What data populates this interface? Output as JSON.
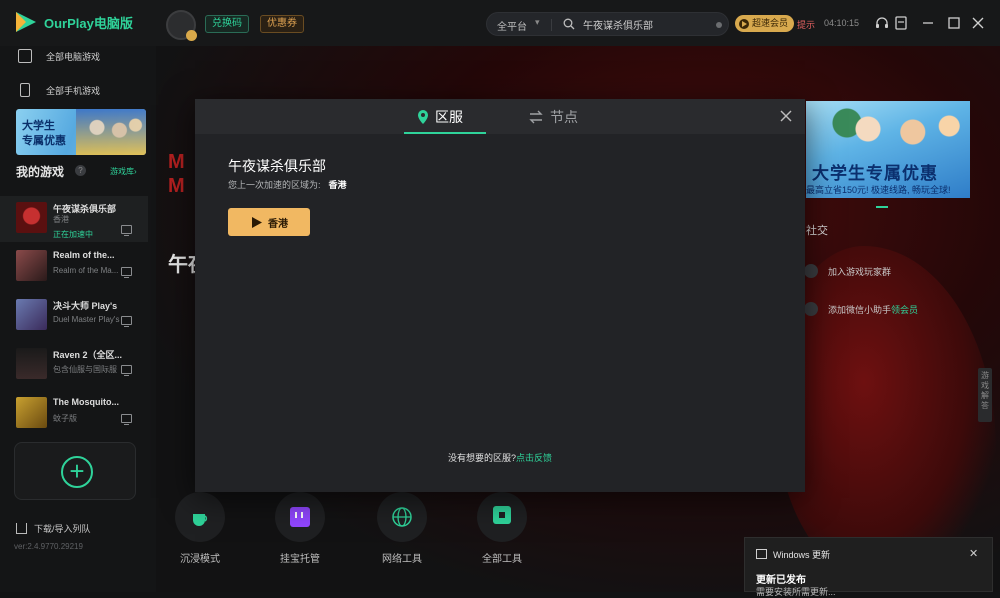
{
  "app": {
    "title": "OurPlay电脑版",
    "redeem_label": "兑换码",
    "coupon_label": "优惠券",
    "platform_filter": "全平台",
    "search_value": "午夜谋杀俱乐部",
    "vip_label": "超速会员",
    "alert_text": "提示",
    "time_text": "04:10:15"
  },
  "sidebar": {
    "nav": [
      {
        "label": "全部电脑游戏",
        "icon": "monitor-icon"
      },
      {
        "label": "全部手机游戏",
        "icon": "phone-icon"
      }
    ],
    "banner": {
      "line1": "大学生",
      "line2": "专属优惠"
    },
    "my_games_title": "我的游戏",
    "library_link": "游戏库",
    "games": [
      {
        "name": "午夜谋杀俱乐部",
        "sub": "香港",
        "status": "正在加速中",
        "thumb_color": "#7a1a1a"
      },
      {
        "name": "Realm of the...",
        "sub": "Realm of the Ma...",
        "thumb_color": "#5a3a3a"
      },
      {
        "name": "决斗大师 Play's",
        "sub": "Duel Master Play's",
        "thumb_color": "#4a5a8a"
      },
      {
        "name": "Raven 2（全区...",
        "sub": "包含仙服与国际服",
        "thumb_color": "#2a2a2a"
      },
      {
        "name": "The Mosquito...",
        "sub": "蚊子版",
        "thumb_color": "#7a6a20"
      }
    ],
    "import_label": "下载/导入列队",
    "version": "ver:2.4.9770.29219"
  },
  "background": {
    "game_title_fragment": "午夜",
    "tools": [
      {
        "label": "沉浸模式",
        "icon": "teacup-icon"
      },
      {
        "label": "挂宝托管",
        "icon": "twitch-icon"
      },
      {
        "label": "网络工具",
        "icon": "globe-icon"
      },
      {
        "label": "全部工具",
        "icon": "toolbox-icon"
      }
    ],
    "banner": {
      "big": "大学生专属优惠",
      "small": "最高立省150元! 极速线路, 畅玩全球!"
    },
    "social_title": "社交",
    "social": [
      {
        "label": "加入游戏玩家群"
      },
      {
        "label": "添加微信小助手",
        "highlight": "领会员"
      }
    ],
    "side_tab": "游戏解答"
  },
  "modal": {
    "tab_region": "区服",
    "tab_node": "节点",
    "game_name": "午夜谋杀俱乐部",
    "last_region_label": "您上一次加速的区域为:",
    "last_region_value": "香港",
    "region_button": "香港",
    "feedback_text": "没有想要的区服?",
    "feedback_link": "点击反馈"
  },
  "toast": {
    "app": "Windows 更新",
    "title": "更新已发布",
    "body": "需要安装所需更新..."
  },
  "colors": {
    "accent": "#2fd39a",
    "gold": "#f1b862",
    "modal_bg": "#222326"
  }
}
